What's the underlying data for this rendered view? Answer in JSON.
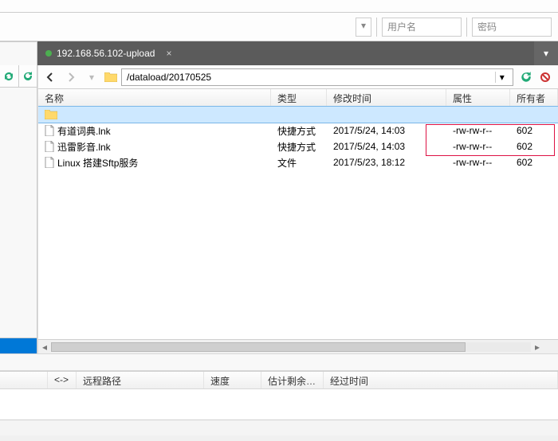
{
  "connect": {
    "user_placeholder": "用户名",
    "pass_placeholder": "密码"
  },
  "tab": {
    "label": "192.168.56.102-upload"
  },
  "address": {
    "path": "/dataload/20170525"
  },
  "columns": {
    "name": "名称",
    "type": "类型",
    "mtime": "修改时间",
    "attr": "属性",
    "owner": "所有者"
  },
  "rows": [
    {
      "kind": "folder",
      "name": "",
      "type": "",
      "mtime": "",
      "attr": "",
      "owner": ""
    },
    {
      "kind": "file",
      "name": "有道词典.lnk",
      "type": "快捷方式",
      "mtime": "2017/5/24, 14:03",
      "attr": "-rw-rw-r--",
      "owner": "602"
    },
    {
      "kind": "file",
      "name": "迅雷影音.lnk",
      "type": "快捷方式",
      "mtime": "2017/5/24, 14:03",
      "attr": "-rw-rw-r--",
      "owner": "602"
    },
    {
      "kind": "file",
      "name": "Linux 搭建Sftp服务",
      "type": "文件",
      "mtime": "2017/5/23, 18:12",
      "attr": "-rw-rw-r--",
      "owner": "602"
    }
  ],
  "queue_columns": {
    "dir": "<->",
    "remote": "远程路径",
    "speed": "速度",
    "eta": "估计剩余…",
    "elapsed": "经过时间"
  },
  "status": {
    "text": ""
  }
}
